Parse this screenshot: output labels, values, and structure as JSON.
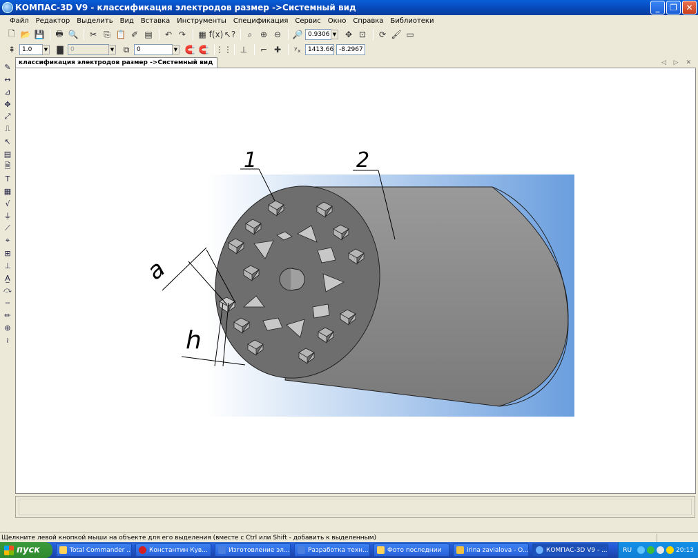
{
  "window": {
    "title": "КОМПАС-3D V9 - классификация электродов размер ->Системный вид",
    "buttons": [
      "minimize",
      "maximize",
      "close"
    ]
  },
  "menu": [
    "Файл",
    "Редактор",
    "Выделить",
    "Вид",
    "Вставка",
    "Инструменты",
    "Спецификация",
    "Сервис",
    "Окно",
    "Справка",
    "Библиотеки"
  ],
  "toolbar": {
    "zoom_value": "0.9306",
    "step_value": "1.0",
    "layer_value": "0",
    "style_value": "0",
    "coord_x": "1413.66",
    "coord_y": "-8.2967"
  },
  "document_tab": {
    "title": "классификация электродов размер ->Системный вид",
    "nav": "◁ ▷ ✕"
  },
  "drawing": {
    "label_1": "1",
    "label_2": "2",
    "label_a": "a",
    "label_h": "h",
    "background_left": "#ffffff",
    "background_right": "#6a9ede",
    "body_color": "#8c8c8c",
    "face_color": "#6e6e6e"
  },
  "status": {
    "hint": "Щелкните левой кнопкой мыши на объекте для его выделения (вместе с Ctrl или Shift - добавить к выделенным)"
  },
  "taskbar": {
    "start_label": "пуск",
    "tasks": [
      "Total Commander ...",
      "Константин Кув...",
      "Изготовление эл...",
      "Разработка техн...",
      "Фото последнии",
      "irina zavialova - O...",
      "КОМПАС-3D V9 - ..."
    ],
    "lang": "RU",
    "time": "20:13"
  }
}
